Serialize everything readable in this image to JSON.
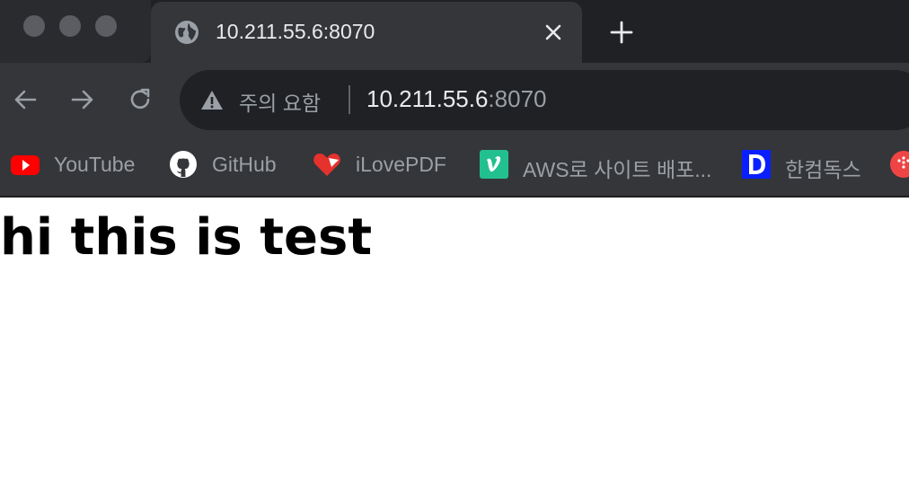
{
  "tab": {
    "title": "10.211.55.6:8070",
    "icon": "globe-icon",
    "close_icon": "close-icon"
  },
  "new_tab": {
    "icon": "plus-icon"
  },
  "toolbar": {
    "back_icon": "arrow-left-icon",
    "forward_icon": "arrow-right-icon",
    "reload_icon": "reload-icon"
  },
  "omnibox": {
    "security_icon": "warning-icon",
    "security_label": "주의 요함",
    "url_host": "10.211.55.6",
    "url_port": ":8070"
  },
  "bookmarks": [
    {
      "label": "YouTube",
      "icon": "youtube-icon",
      "color": "#ff0000"
    },
    {
      "label": "GitHub",
      "icon": "github-icon",
      "color": "#ffffff"
    },
    {
      "label": "iLovePDF",
      "icon": "ilovepdf-icon",
      "color": "#e5322d"
    },
    {
      "label": "AWS로 사이트 배포...",
      "icon": "vimeo-icon",
      "color": "#1ab7ea"
    },
    {
      "label": "한컴독스",
      "icon": "hancom-docs-icon",
      "color": "#0033ff"
    },
    {
      "label": "",
      "icon": "app-icon",
      "color": "#ef4444"
    }
  ],
  "page": {
    "heading": "hi this is test"
  },
  "colors": {
    "tabstrip_bg": "#202124",
    "toolbar_bg": "#35363a",
    "omnibox_bg": "#202124",
    "text_primary": "#e8eaed",
    "text_secondary": "#9aa0a6"
  }
}
